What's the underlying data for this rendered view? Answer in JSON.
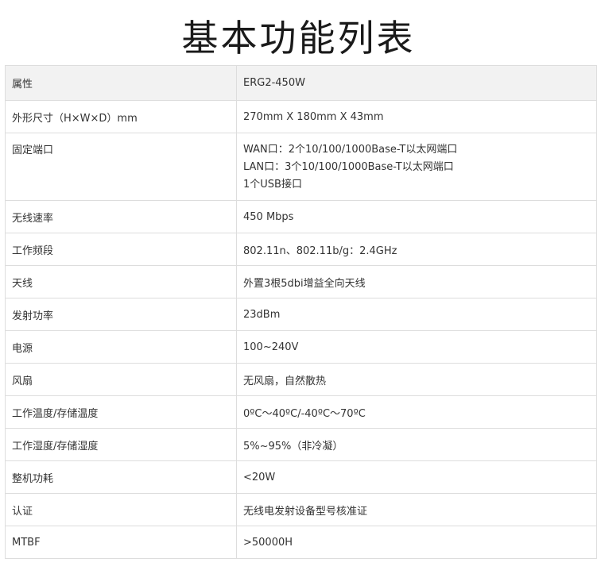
{
  "title": "基本功能列表",
  "header": {
    "attr": "属性",
    "value": "ERG2-450W"
  },
  "rows": [
    {
      "attr": "外形尺寸（H×W×D）mm",
      "value": "270mm X 180mm X 43mm"
    },
    {
      "attr": "固定端口",
      "lines": [
        "WAN口：2个10/100/1000Base-T以太网端口",
        "LAN口：3个10/100/1000Base-T以太网端口",
        "1个USB接口"
      ]
    },
    {
      "attr": "无线速率",
      "value": "450 Mbps"
    },
    {
      "attr": "工作频段",
      "value": "802.11n、802.11b/g：2.4GHz"
    },
    {
      "attr": "天线",
      "value": "外置3根5dbi增益全向天线"
    },
    {
      "attr": "发射功率",
      "value": "23dBm"
    },
    {
      "attr": "电源",
      "value": "100~240V"
    },
    {
      "attr": "风扇",
      "value": "无风扇，自然散热"
    },
    {
      "attr": "工作温度/存储温度",
      "value": "0ºC～40ºC/-40ºC～70ºC"
    },
    {
      "attr": "工作湿度/存储湿度",
      "value": "5%~95%（非冷凝）"
    },
    {
      "attr": "整机功耗",
      "value": "<20W"
    },
    {
      "attr": "认证",
      "value": "无线电发射设备型号核准证"
    },
    {
      "attr": "MTBF",
      "value": ">50000H"
    }
  ]
}
